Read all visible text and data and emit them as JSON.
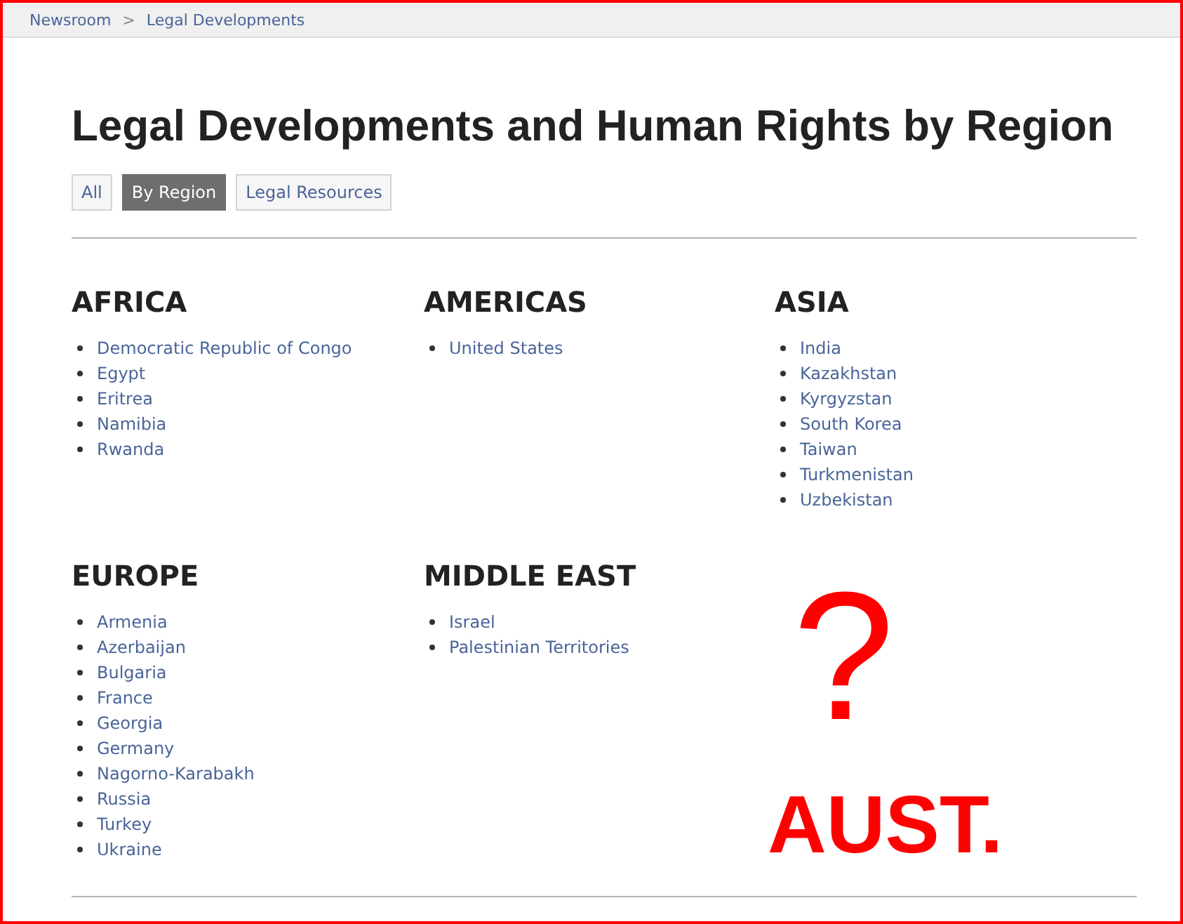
{
  "breadcrumb": {
    "items": [
      "Newsroom",
      "Legal Developments"
    ],
    "separator": ">"
  },
  "title": "Legal Developments and Human Rights by Region",
  "tabs": [
    {
      "label": "All",
      "selected": false
    },
    {
      "label": "By Region",
      "selected": true
    },
    {
      "label": "Legal Resources",
      "selected": false
    }
  ],
  "regions": [
    {
      "name": "AFRICA",
      "items": [
        "Democratic Republic of Congo",
        "Egypt",
        "Eritrea",
        "Namibia",
        "Rwanda"
      ]
    },
    {
      "name": "AMERICAS",
      "items": [
        "United States"
      ]
    },
    {
      "name": "ASIA",
      "items": [
        "India",
        "Kazakhstan",
        "Kyrgyzstan",
        "South Korea",
        "Taiwan",
        "Turkmenistan",
        "Uzbekistan"
      ]
    },
    {
      "name": "EUROPE",
      "items": [
        "Armenia",
        "Azerbaijan",
        "Bulgaria",
        "France",
        "Georgia",
        "Germany",
        "Nagorno-Karabakh",
        "Russia",
        "Turkey",
        "Ukraine"
      ]
    },
    {
      "name": "MIDDLE EAST",
      "items": [
        "Israel",
        "Palestinian Territories"
      ]
    }
  ],
  "annotation": {
    "mark": "?",
    "text": "AUST."
  }
}
